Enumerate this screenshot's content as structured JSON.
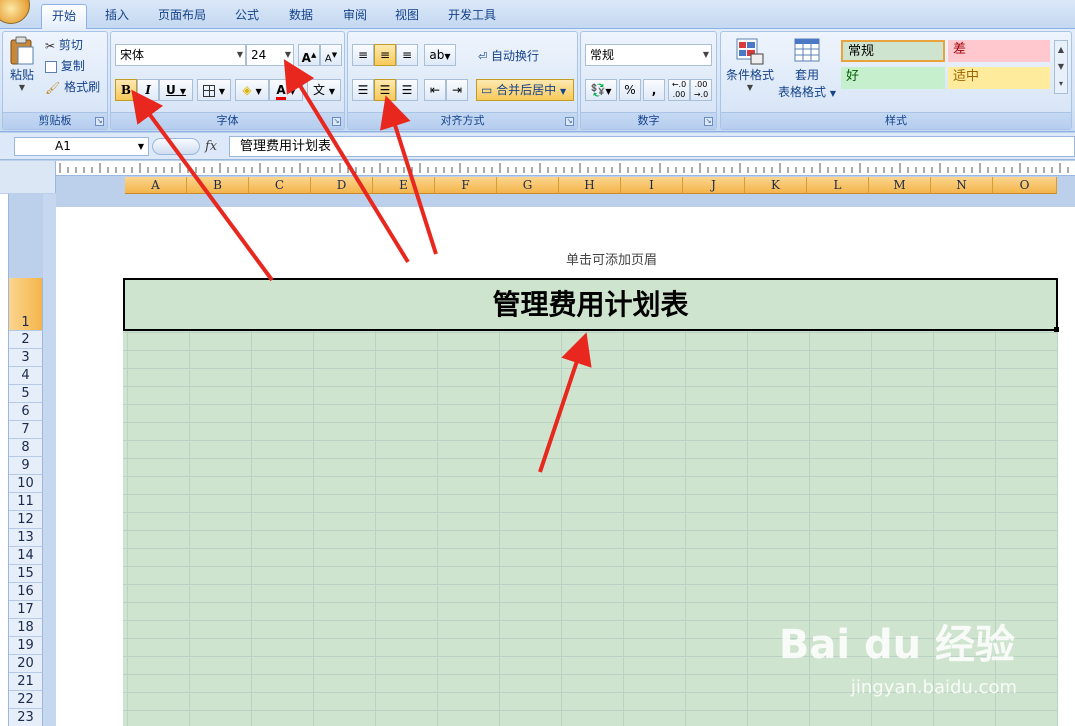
{
  "tabs": [
    {
      "label": "开始",
      "active": true
    },
    {
      "label": "插入"
    },
    {
      "label": "页面布局"
    },
    {
      "label": "公式"
    },
    {
      "label": "数据"
    },
    {
      "label": "审阅"
    },
    {
      "label": "视图"
    },
    {
      "label": "开发工具"
    }
  ],
  "clipboard": {
    "paste": "粘贴",
    "cut": "剪切",
    "copy": "复制",
    "format_painter": "格式刷",
    "label": "剪贴板"
  },
  "font": {
    "name": "宋体",
    "size": "24",
    "grow": "A",
    "shrink": "A",
    "bold": "B",
    "italic": "I",
    "underline": "U",
    "color_glyph": "A",
    "phonetic": "文",
    "label": "字体"
  },
  "alignment": {
    "wrap": "自动换行",
    "merge": "合并后居中",
    "label": "对齐方式"
  },
  "number": {
    "format": "常规",
    "percent": "%",
    "comma": ",",
    "inc": "+.0 .00",
    "dec": ".00 →.0",
    "label": "数字"
  },
  "styles": {
    "conditional": "条件格式",
    "table1": "套用",
    "table2": "表格格式",
    "cells": [
      {
        "text": "常规",
        "bg": "#cfe4cf",
        "border": "#e8a33c",
        "color": "#000000"
      },
      {
        "text": "差",
        "bg": "#ffc7ce",
        "border": "#ffc7ce",
        "color": "#9c0006"
      },
      {
        "text": "好",
        "bg": "#c6efce",
        "border": "#c6efce",
        "color": "#006100"
      },
      {
        "text": "适中",
        "bg": "#ffeb9c",
        "border": "#ffeb9c",
        "color": "#9c6500"
      }
    ],
    "label": "样式"
  },
  "formula_bar": {
    "cell_ref": "A1",
    "fx": "fx",
    "content": "管理费用计划表"
  },
  "columns": [
    "A",
    "B",
    "C",
    "D",
    "E",
    "F",
    "G",
    "H",
    "I",
    "J",
    "K",
    "L",
    "M",
    "N",
    "O"
  ],
  "rows": [
    "1",
    "2",
    "3",
    "4",
    "5",
    "6",
    "7",
    "8",
    "9",
    "10",
    "11",
    "12",
    "13",
    "14",
    "15",
    "16",
    "17",
    "18",
    "19",
    "20",
    "21",
    "22",
    "23"
  ],
  "page": {
    "header_hint": "单击可添加页眉",
    "title": "管理费用计划表"
  },
  "watermark": {
    "brand": "Bai du 经验",
    "url": "jingyan.baidu.com"
  },
  "colors": {
    "accent": "#15428b",
    "arrow": "#e8281e",
    "selection": "#f4b54a"
  }
}
